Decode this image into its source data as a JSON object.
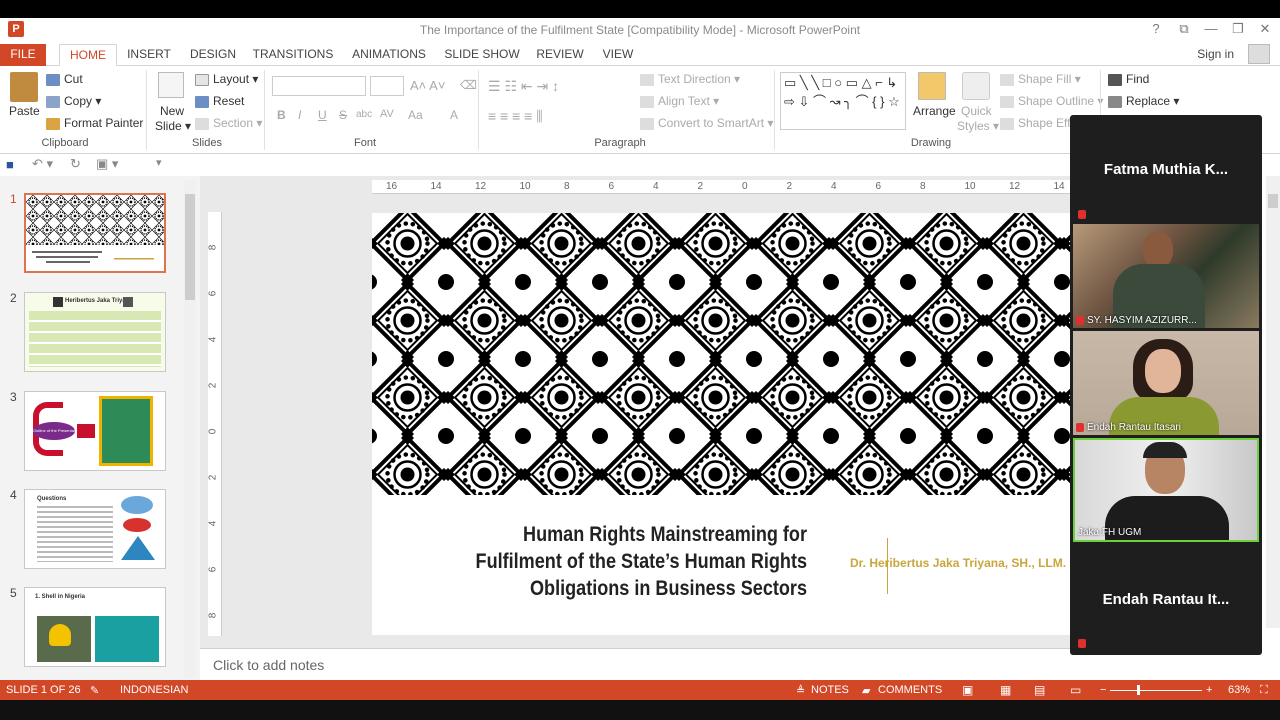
{
  "window": {
    "title": "The Importance of the Fulfilment State [Compatibility Mode] - Microsoft PowerPoint",
    "help": "?",
    "restore_ribbon": "⧉",
    "minimize": "—",
    "maximize": "❐",
    "close": "✕"
  },
  "tabs": [
    {
      "label": "FILE"
    },
    {
      "label": "HOME"
    },
    {
      "label": "INSERT"
    },
    {
      "label": "DESIGN"
    },
    {
      "label": "TRANSITIONS"
    },
    {
      "label": "ANIMATIONS"
    },
    {
      "label": "SLIDE SHOW"
    },
    {
      "label": "REVIEW"
    },
    {
      "label": "VIEW"
    }
  ],
  "account": {
    "signin": "Sign in"
  },
  "ribbon": {
    "clipboard": {
      "label": "Clipboard",
      "paste": "Paste",
      "cut": "Cut",
      "copy": "Copy",
      "format_painter": "Format Painter"
    },
    "slides": {
      "label": "Slides",
      "new_slide_line1": "New",
      "new_slide_line2": "Slide",
      "layout": "Layout",
      "reset": "Reset",
      "section": "Section"
    },
    "font": {
      "label": "Font",
      "bold": "B",
      "italic": "I",
      "underline": "U",
      "strike": "S",
      "shadow": "abc",
      "spacing": "AV",
      "case": "Aa",
      "color": "A"
    },
    "paragraph": {
      "label": "Paragraph",
      "text_direction": "Text Direction",
      "align_text": "Align Text",
      "convert_smartart": "Convert to SmartArt"
    },
    "drawing": {
      "label": "Drawing",
      "arrange": "Arrange",
      "quick_styles_line1": "Quick",
      "quick_styles_line2": "Styles",
      "shape_fill": "Shape Fill",
      "shape_outline": "Shape Outline",
      "shape_effects": "Shape Effe"
    },
    "editing": {
      "find": "Find",
      "replace": "Replace"
    }
  },
  "thumbnails": [
    {
      "num": "1"
    },
    {
      "num": "2",
      "heading": "Heribertus Jaka Triyana"
    },
    {
      "num": "3",
      "center": "Outline of the Presentation"
    },
    {
      "num": "4",
      "heading": "Questions"
    },
    {
      "num": "5",
      "heading": "1. Shell in Nigeria"
    }
  ],
  "ruler": {
    "h": [
      "16",
      "14",
      "12",
      "10",
      "8",
      "6",
      "4",
      "2",
      "0",
      "2",
      "4",
      "6",
      "8",
      "10",
      "12",
      "14"
    ],
    "v": [
      "8",
      "6",
      "4",
      "2",
      "0",
      "2",
      "4",
      "6",
      "8"
    ]
  },
  "slide": {
    "title": "Human Rights Mainstreaming for Fulfilment of the State’s Human Rights Obligations in Business Sectors",
    "author": "Dr. Heribertus Jaka Triyana, SH., LLM. M"
  },
  "notes": {
    "placeholder": "Click to add notes"
  },
  "status": {
    "slide": "SLIDE 1 OF 26",
    "language": "INDONESIAN",
    "notes": "NOTES",
    "comments": "COMMENTS",
    "zoom": "63%"
  },
  "participants": [
    {
      "name": "Fatma Muthia K...",
      "video": false
    },
    {
      "name": "SY. HASYIM AZIZURR...",
      "video": true
    },
    {
      "name": "Endah Rantau Itasari",
      "video": true
    },
    {
      "name": "Jaka FH UGM",
      "video": true
    },
    {
      "name": "Endah Rantau It...",
      "video": false
    }
  ],
  "colors": {
    "accent": "#d24726",
    "gold": "#c9a63c"
  }
}
